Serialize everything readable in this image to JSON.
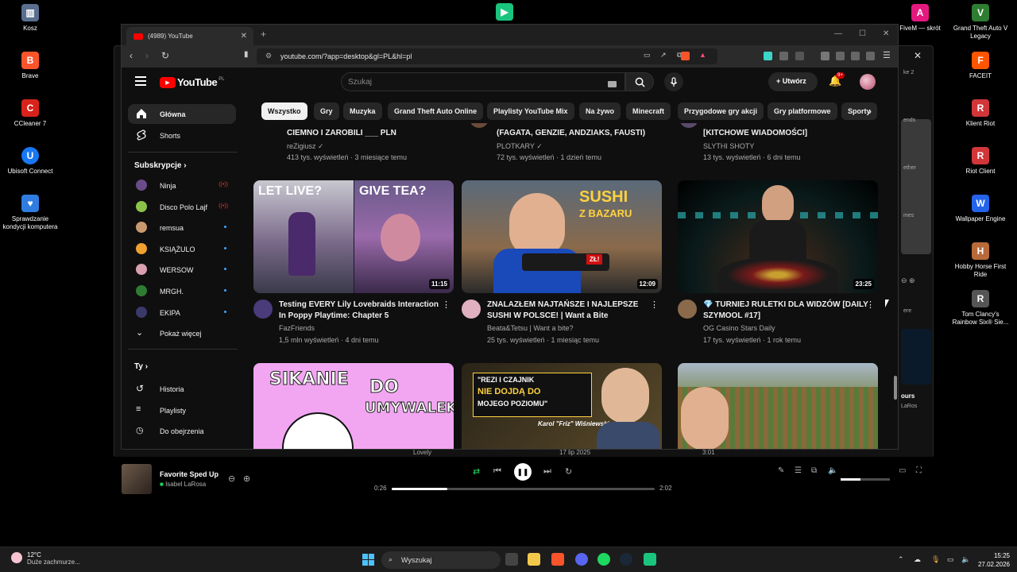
{
  "desktop": {
    "left_icons": [
      {
        "label": "Kosz",
        "color": "#5a6f8f",
        "glyph": "🗑"
      },
      {
        "label": "Brave",
        "color": "#fb542b",
        "glyph": "B"
      },
      {
        "label": "CCleaner 7",
        "color": "#d8231b",
        "glyph": "C"
      },
      {
        "label": "Ubisoft Connect",
        "color": "#1877f2",
        "glyph": "U"
      },
      {
        "label": "Sprawdzanie kondycji komputera",
        "color": "#2f7de1",
        "glyph": "♥"
      }
    ],
    "top_icon": {
      "label": "Steam Link Desktop",
      "color": "#1bc47d"
    },
    "right_icons": [
      {
        "label": "FiveM — skrót",
        "color": "#e4197f",
        "glyph": "A"
      },
      {
        "label": "Grand Theft Auto V Legacy",
        "color": "#2e7d32",
        "glyph": "V"
      },
      {
        "label": "FACEIT",
        "color": "#ff5500",
        "glyph": "F"
      },
      {
        "label": "Klient Riot",
        "color": "#d13639",
        "glyph": "R"
      },
      {
        "label": "Riot Client",
        "color": "#d13639",
        "glyph": "R"
      },
      {
        "label": "Wallpaper Engine",
        "color": "#2563eb",
        "glyph": "W"
      },
      {
        "label": "Hobby Horse First Ride",
        "color": "#b86a3a",
        "glyph": "H"
      },
      {
        "label": "Tom Clancy's Rainbow Six® Sie...",
        "color": "#555555",
        "glyph": "R"
      }
    ],
    "peek_texts": [
      "ke 2",
      "ends",
      "ether",
      "mes",
      "ere",
      "ours",
      "LaRos"
    ]
  },
  "spotify": {
    "track_title": "Favorite Sped Up",
    "track_artist": "Isabel LaRosa",
    "time_current": "0:26",
    "time_total": "2:02",
    "progress": 0.21,
    "volume": 0.4,
    "bg_texts": [
      "Lovely",
      "17 lip 2025",
      "3:01"
    ]
  },
  "browser": {
    "tab_title": "(4989) YouTube",
    "url": "youtube.com/?app=desktop&gl=PL&hl=pl"
  },
  "youtube": {
    "logo_text": "YouTube",
    "logo_region": "PL",
    "search_placeholder": "Szukaj",
    "create_label": "Utwórz",
    "notif_count": "9+",
    "sidebar": {
      "home": "Główna",
      "shorts": "Shorts",
      "subs_heading": "Subskrypcje",
      "subs": [
        {
          "name": "Ninja",
          "status": "live",
          "color": "#6b4c8a"
        },
        {
          "name": "Disco Polo Lajf",
          "status": "live",
          "color": "#8bc34a"
        },
        {
          "name": "remsua",
          "status": "dot",
          "color": "#c89a6e"
        },
        {
          "name": "KSIĄŻULO",
          "status": "dot",
          "color": "#f0a030"
        },
        {
          "name": "WERSOW",
          "status": "dot",
          "color": "#d9a0b0"
        },
        {
          "name": "MRGH.",
          "status": "dot",
          "color": "#2e7d32"
        },
        {
          "name": "EKIPA",
          "status": "dot",
          "color": "#3a3a6a"
        }
      ],
      "more": "Pokaż więcej",
      "you_heading": "Ty",
      "you_items": [
        "Historia",
        "Playlisty",
        "Do obejrzenia"
      ]
    },
    "chips": [
      "Wszystko",
      "Gry",
      "Muzyka",
      "Grand Theft Auto Online",
      "Playlisty YouTube Mix",
      "Na żywo",
      "Minecraft",
      "Przygodowe gry akcji",
      "Gry platformowe",
      "Sporty"
    ],
    "top_row": [
      {
        "title": "CIEMNO I ZAROBILI ___ PLN",
        "channel": "reZigiusz",
        "verified": true,
        "meta": "413 tys. wyświetleń · 3 miesiące temu"
      },
      {
        "title": "(FAGATA, GENZIE, ANDZIAKS, FAUSTI)",
        "channel": "PLOTKARY",
        "verified": true,
        "meta": "72 tys. wyświetleń · 1 dzień temu"
      },
      {
        "title": "[KITCHOWE WIADOMOŚCI]",
        "channel": "SLYTHI SHOTY",
        "verified": false,
        "meta": "13 tys. wyświetleń · 6 dni temu"
      }
    ],
    "videos": [
      {
        "title": "Testing EVERY Lily Lovebraids Interaction In Poppy Playtime: Chapter 5",
        "channel": "FazFriends",
        "meta": "1,5 mln wyświetleń · 4 dni temu",
        "duration": "11:15",
        "thumb_left_text": "LET LIVE?",
        "thumb_right_text": "GIVE TEA?",
        "avatar_color": "#4a3b7a"
      },
      {
        "title": "ZNALAZŁEM NAJTAŃSZE I NAJLEPSZE SUSHI W POLSCE! | Want a Bite",
        "channel": "Beata&Tetsu | Want a bite?",
        "meta": "25 tys. wyświetleń · 1 miesiąc temu",
        "duration": "12:09",
        "thumb_text_1": "SUSHI",
        "thumb_text_2": "Z BAZARU",
        "thumb_tag": "ZŁ!",
        "avatar_color": "#e0b0c0"
      },
      {
        "title": "💎 TURNIEJ RULETKI DLA WIDZÓW [DAILY SZYMOOL #17]",
        "channel": "OG Casino Stars Daily",
        "meta": "17 tys. wyświetleń · 1 rok temu",
        "duration": "23:25",
        "avatar_color": "#8a6a4a"
      }
    ],
    "bottom_row": [
      {
        "thumb_text_1": "SIKANIE",
        "thumb_text_2": "DO",
        "thumb_text_3": "UMYWALEK"
      },
      {
        "thumb_text_1": "\"REZI I CZAJNIK",
        "thumb_text_2": "NIE DOJDĄ DO",
        "thumb_text_3": "MOJEGO POZIOMU\"",
        "thumb_name": "Karol \"Friz\" Wiśniewski"
      },
      {}
    ]
  },
  "taskbar": {
    "temp": "12°C",
    "weather": "Duże zachmurze...",
    "search_label": "Wyszukaj",
    "time": "15:25",
    "date": "27.02.2026"
  }
}
